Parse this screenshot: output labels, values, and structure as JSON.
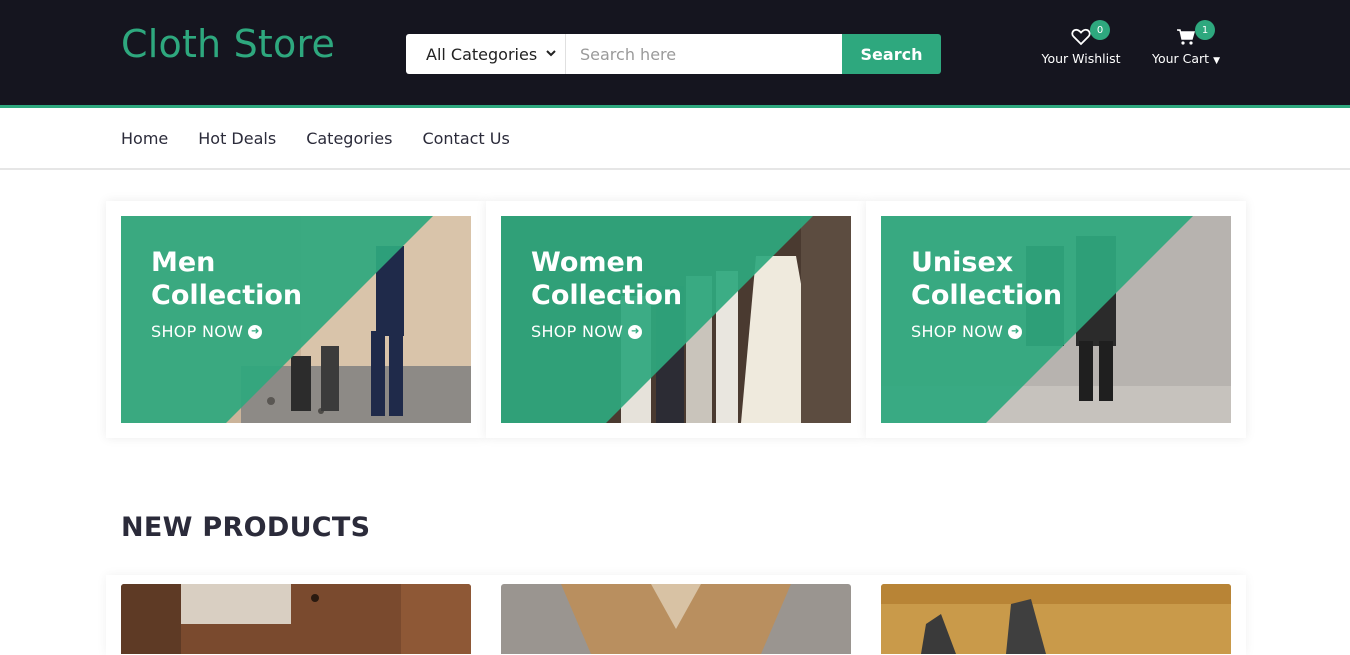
{
  "brand": {
    "logo": "Cloth Store",
    "accent": "#2ea87e",
    "header_bg": "#15151f"
  },
  "search": {
    "category": "All Categories",
    "placeholder": "Search here",
    "button": "Search"
  },
  "wishlist": {
    "label": "Your Wishlist",
    "count": "0",
    "icon": "heart-icon"
  },
  "cart": {
    "label": "Your Cart",
    "count": "1",
    "icon": "cart-icon"
  },
  "nav": {
    "items": [
      "Home",
      "Hot Deals",
      "Categories",
      "Contact Us"
    ]
  },
  "collections": [
    {
      "title_line1": "Men",
      "title_line2": "Collection",
      "cta": "SHOP NOW"
    },
    {
      "title_line1": "Women",
      "title_line2": "Collection",
      "cta": "SHOP NOW"
    },
    {
      "title_line1": "Unisex",
      "title_line2": "Collection",
      "cta": "SHOP NOW"
    }
  ],
  "new_products": {
    "title": "NEW PRODUCTS"
  }
}
